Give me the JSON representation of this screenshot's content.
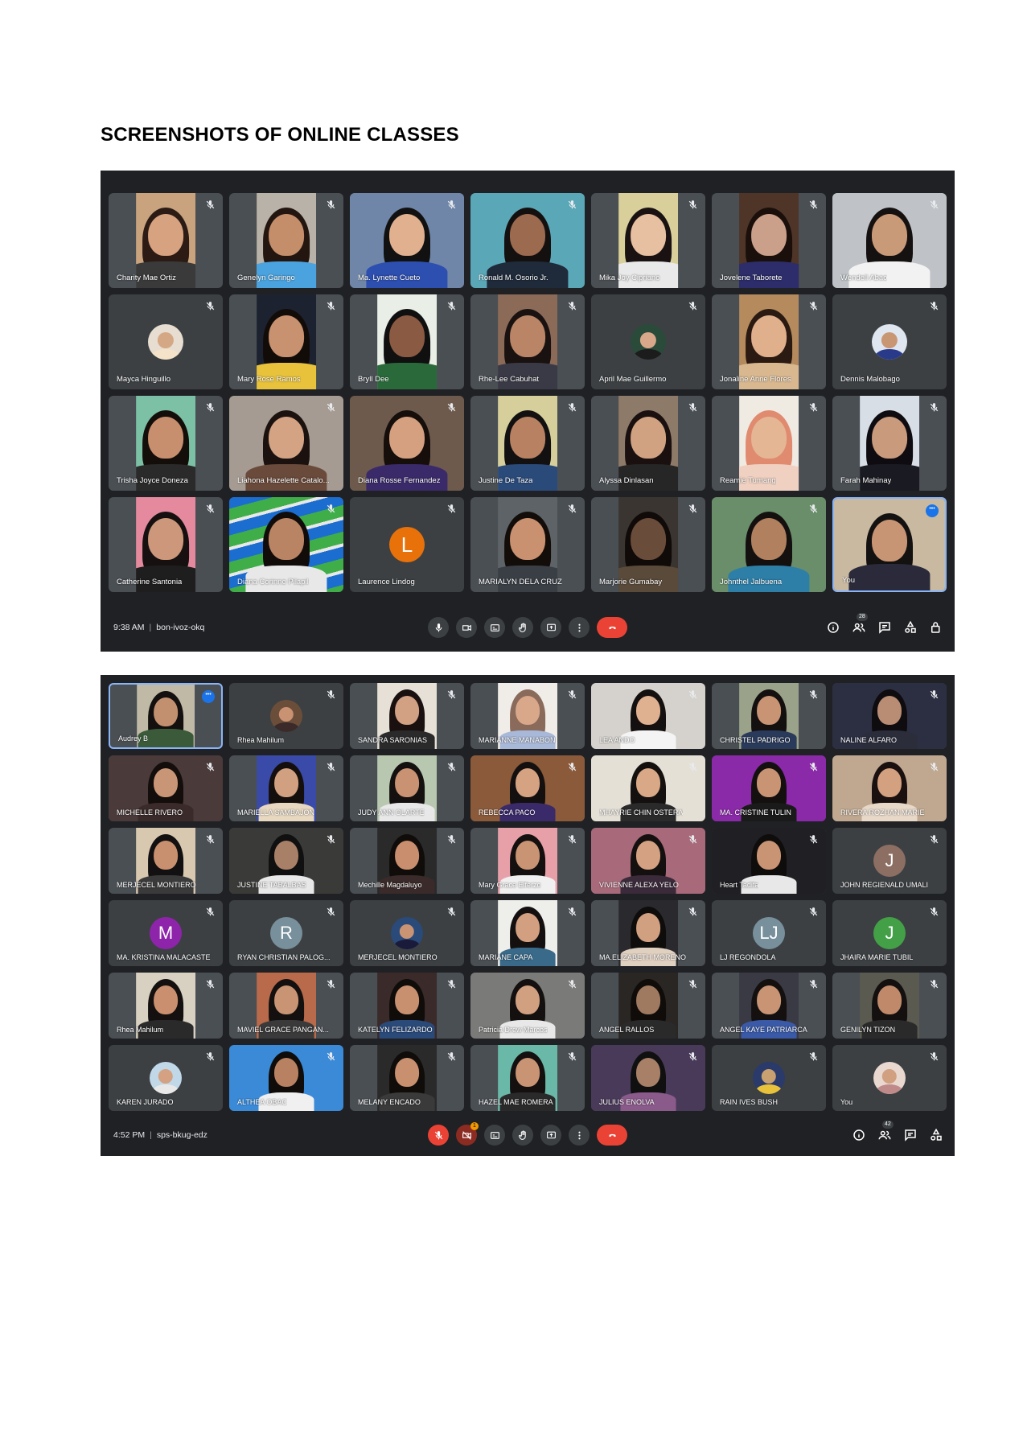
{
  "page_title": "SCREENSHOTS OF ONLINE CLASSES",
  "meeting1": {
    "time": "9:38 AM",
    "code": "bon-ivoz-okq",
    "participant_count": "28",
    "tiles": [
      {
        "name": "Charity Mae Ortiz",
        "kind": "video",
        "bg": "#c9a37e",
        "skin": "#d7a27f",
        "hair": "#2b1b14",
        "shirt": "#3a3a3a"
      },
      {
        "name": "Genelyn Garingo",
        "kind": "video",
        "bg": "#b9b2a8",
        "skin": "#c48e6b",
        "hair": "#231510",
        "shirt": "#4aa3df"
      },
      {
        "name": "Ma. Lynette Cueto",
        "kind": "wide",
        "bg": "#6f86a8",
        "skin": "#e0b08f",
        "hair": "#111111",
        "shirt": "#2d4fb0"
      },
      {
        "name": "Ronald M. Osorio Jr.",
        "kind": "wide",
        "bg": "#5aa7b8",
        "skin": "#9b6a4f",
        "hair": "#151010",
        "shirt": "#1f2a3a"
      },
      {
        "name": "Mika Joy Cipriano",
        "kind": "video",
        "bg": "#d8cf9a",
        "skin": "#e7bfa1",
        "hair": "#1a1212",
        "shirt": "#e9e9e9"
      },
      {
        "name": "Jovelene Taborete",
        "kind": "video",
        "bg": "#4e3528",
        "skin": "#caa08a",
        "hair": "#1a0f0b",
        "shirt": "#2c2d6a"
      },
      {
        "name": "Wendell Abao",
        "kind": "wide",
        "bg": "#bfc3c7",
        "skin": "#c99a78",
        "hair": "#161111",
        "shirt": "#f2f2f2"
      },
      {
        "name": "Mayca Hinguillo",
        "kind": "photo",
        "bg": "#e7ddd0",
        "skin": "#d4a785",
        "shirt": "#f4e3c8"
      },
      {
        "name": "Mary Rose Ramos",
        "kind": "video",
        "bg": "#1d2230",
        "skin": "#c89170",
        "hair": "#120c09",
        "shirt": "#e8c23a"
      },
      {
        "name": "Bryll Dee",
        "kind": "video",
        "bg": "#e9efe6",
        "skin": "#8a5a42",
        "hair": "#101010",
        "shirt": "#2a6a3a"
      },
      {
        "name": "Rhe-Lee Cabuhat",
        "kind": "video",
        "bg": "#8c6a58",
        "skin": "#b98566",
        "hair": "#1a1210",
        "shirt": "#3a3a46"
      },
      {
        "name": "April Mae Guillermo",
        "kind": "photo",
        "bg": "#2a4a3a",
        "skin": "#d9a88a",
        "shirt": "#1c1c1c"
      },
      {
        "name": "Jonaline Anne Flores",
        "kind": "video",
        "bg": "#b58b5d",
        "skin": "#e0af8c",
        "hair": "#2a1a12",
        "shirt": "#d9b890"
      },
      {
        "name": "Dennis Malobago",
        "kind": "photo",
        "bg": "#dfe6f0",
        "skin": "#c99674",
        "shirt": "#2a3a8a"
      },
      {
        "name": "Trisha Joyce Doneza",
        "kind": "video",
        "bg": "#7cc0a5",
        "skin": "#c88f6e",
        "hair": "#140e0b",
        "shirt": "#2a2a2a"
      },
      {
        "name": "Liahona Hazelette Catalo...",
        "kind": "wide",
        "bg": "#a59b92",
        "skin": "#d3a384",
        "hair": "#1b1210",
        "shirt": "#6a4a3a"
      },
      {
        "name": "Diana Rosse Fernandez",
        "kind": "wide",
        "bg": "#6d5a4c",
        "skin": "#d4a080",
        "hair": "#150e0b",
        "shirt": "#3a2a6a"
      },
      {
        "name": "Justine De Taza",
        "kind": "video",
        "bg": "#d6cf9b",
        "skin": "#b88162",
        "hair": "#121010",
        "shirt": "#2a4a7a"
      },
      {
        "name": "Alyssa Dinlasan",
        "kind": "video",
        "bg": "#8e7a68",
        "skin": "#d0a282",
        "hair": "#1a1010",
        "shirt": "#262626"
      },
      {
        "name": "Reamie Tumang",
        "kind": "video",
        "bg": "#efeae2",
        "skin": "#e4b693",
        "hair": "#e08a70",
        "shirt": "#f0d0c0"
      },
      {
        "name": "Farah Mahinay",
        "kind": "video",
        "bg": "#d8dee6",
        "skin": "#c99a7c",
        "hair": "#0e0c10",
        "shirt": "#1a1a22"
      },
      {
        "name": "Catherine Santonia",
        "kind": "video",
        "bg": "#e58a9e",
        "skin": "#cc977a",
        "hair": "#161010",
        "shirt": "#1e1e1e"
      },
      {
        "name": "Diana Corinne Pilapil",
        "kind": "stripes",
        "bg": "#1c6dd0",
        "skin": "#b98464",
        "hair": "#110c0a",
        "shirt": "#e8e8e8"
      },
      {
        "name": "Laurence Lindog",
        "kind": "letter",
        "letter": "L",
        "color": "#e8710a"
      },
      {
        "name": "MARIALYN DELA CRUZ",
        "kind": "video",
        "bg": "#5d6367",
        "skin": "#c99170",
        "hair": "#130d0a",
        "shirt": "#3a3f46"
      },
      {
        "name": "Marjorie Gumabay",
        "kind": "video",
        "bg": "#3a3530",
        "skin": "#6a4c3a",
        "hair": "#100a08",
        "shirt": "#5a4a3a"
      },
      {
        "name": "Johnthel Jalbuena",
        "kind": "wide",
        "bg": "#6a8e6a",
        "skin": "#b0805f",
        "hair": "#141010",
        "shirt": "#2d7fa8"
      },
      {
        "name": "You",
        "kind": "wide",
        "bg": "#c9b9a0",
        "skin": "#c89574",
        "hair": "#141111",
        "shirt": "#2a2a3a",
        "pinned": true
      }
    ]
  },
  "meeting2": {
    "time": "4:52 PM",
    "code": "sps-bkug-edz",
    "participant_count": "42",
    "notification_count": "1",
    "tiles": [
      {
        "name": "Audrey B",
        "kind": "video",
        "bg": "#c0b9a6",
        "skin": "#c2906f",
        "hair": "#141010",
        "shirt": "#3a5a3a",
        "pinned": true
      },
      {
        "name": "Rhea Mahilum",
        "kind": "photo",
        "bg": "#6a4e3a",
        "skin": "#c99272",
        "shirt": "#3a2a2a"
      },
      {
        "name": "SANDRA SARONIAS",
        "kind": "video",
        "bg": "#e6e0d6",
        "skin": "#d2a083",
        "hair": "#1a1010",
        "shirt": "#2a2a2a"
      },
      {
        "name": "MARIANNE MANABON",
        "kind": "video",
        "bg": "#f0ede8",
        "skin": "#d9a88a",
        "hair": "#8a6a5a",
        "shirt": "#a8b8d8"
      },
      {
        "name": "LEA ANDO",
        "kind": "wide",
        "bg": "#d5d2cd",
        "skin": "#e0b190",
        "hair": "#151010",
        "shirt": "#f4f4f4"
      },
      {
        "name": "CHRISTEL PADRIGO",
        "kind": "video",
        "bg": "#9aa38a",
        "skin": "#c99474",
        "hair": "#141010",
        "shirt": "#2a3a5a"
      },
      {
        "name": "NALINE ALFARO",
        "kind": "wide",
        "bg": "#2c2f42",
        "skin": "#b98c74",
        "hair": "#0f0c10",
        "shirt": "#2b2d3b"
      },
      {
        "name": "MICHELLE RIVERO",
        "kind": "wide",
        "bg": "#4a3a3a",
        "skin": "#c99577",
        "hair": "#130d0b",
        "shirt": "#3a2a2a"
      },
      {
        "name": "MARIELLA SAMBAJON",
        "kind": "video",
        "bg": "#3a4aa8",
        "skin": "#d0a080",
        "hair": "#140f0c",
        "shirt": "#e8d8c0"
      },
      {
        "name": "JUDY ANN OLARTE",
        "kind": "video",
        "bg": "#b8c8b0",
        "skin": "#c99272",
        "hair": "#141010",
        "shirt": "#e8e8e8"
      },
      {
        "name": "REBECCA PACO",
        "kind": "wide",
        "bg": "#8a5a3a",
        "skin": "#d5a282",
        "hair": "#141010",
        "shirt": "#3a2a6a"
      },
      {
        "name": "MHAYRIE CHIN OSTERA",
        "kind": "wide",
        "bg": "#e5e0d6",
        "skin": "#d9a886",
        "hair": "#141010",
        "shirt": "#2a2a2a"
      },
      {
        "name": "MA. CRISTINE TULIN",
        "kind": "wide",
        "bg": "#8a2aa8",
        "skin": "#c99474",
        "hair": "#141010",
        "shirt": "#1a1a1a"
      },
      {
        "name": "RIVERA ROZHAN MARIE",
        "kind": "wide",
        "bg": "#c0a890",
        "skin": "#d3a080",
        "hair": "#1a1010",
        "shirt": "#e8d8c8"
      },
      {
        "name": "MERJECEL MONTIERO",
        "kind": "video",
        "bg": "#d8c8b0",
        "skin": "#c99070",
        "hair": "#121010",
        "shirt": "#3a3a3a"
      },
      {
        "name": "JUSTINE TABALBAS",
        "kind": "wide",
        "bg": "#3a3a38",
        "skin": "#a88068",
        "hair": "#101010",
        "shirt": "#e8e8e8"
      },
      {
        "name": "Mechille Magdaluyo",
        "kind": "video",
        "bg": "#2a2a2a",
        "skin": "#c98e6e",
        "hair": "#0f0c0a",
        "shirt": "#3a2a2a"
      },
      {
        "name": "Mary Grace Elferzo",
        "kind": "video",
        "bg": "#e8a0a8",
        "skin": "#c99474",
        "hair": "#141010",
        "shirt": "#f0f0f0"
      },
      {
        "name": "VIVIENNE ALEXA YELO",
        "kind": "wide",
        "bg": "#a86a7a",
        "skin": "#d4a282",
        "hair": "#151010",
        "shirt": "#3a2a3a"
      },
      {
        "name": "Heart Tadifa",
        "kind": "wide",
        "bg": "#1f1f24",
        "skin": "#c89474",
        "hair": "#0f0c0c",
        "shirt": "#e8e8e8"
      },
      {
        "name": "JOHN REGIENALD UMALI",
        "kind": "letter",
        "letter": "J",
        "color": "#8d6e63"
      },
      {
        "name": "MA. KRISTINA MALACASTE",
        "kind": "letter",
        "letter": "M",
        "color": "#8e24aa"
      },
      {
        "name": "RYAN CHRISTIAN PALOG...",
        "kind": "letter",
        "letter": "R",
        "color": "#78909c"
      },
      {
        "name": "MERJECEL MONTIERO",
        "kind": "photo",
        "bg": "#2a4a7a",
        "skin": "#c99474",
        "shirt": "#1a1a3a"
      },
      {
        "name": "MARIANE CAPA",
        "kind": "video",
        "bg": "#eeeeea",
        "skin": "#d2a080",
        "hair": "#141010",
        "shirt": "#3a6a8a"
      },
      {
        "name": "MA.ELIZABETH MORENO",
        "kind": "video",
        "bg": "#2a2a2e",
        "skin": "#d0a080",
        "hair": "#0f0c0c",
        "shirt": "#e0d0c0"
      },
      {
        "name": "LJ REGONDOLA",
        "kind": "letter",
        "letter": "LJ",
        "color": "#78909c"
      },
      {
        "name": "JHAIRA MARIE TUBIL",
        "kind": "letter",
        "letter": "J",
        "color": "#43a047"
      },
      {
        "name": "Rhea Mahilum",
        "kind": "video",
        "bg": "#d8d0c0",
        "skin": "#c98f6e",
        "hair": "#141010",
        "shirt": "#2a2a2a"
      },
      {
        "name": "MAVIEL GRACE PANGAN...",
        "kind": "video",
        "bg": "#b86a4a",
        "skin": "#c99474",
        "hair": "#141010",
        "shirt": "#3a3a3a"
      },
      {
        "name": "KATELYN FELIZARDO",
        "kind": "video",
        "bg": "#3a2a2a",
        "skin": "#c99070",
        "hair": "#0f0c0a",
        "shirt": "#2a4a7a"
      },
      {
        "name": "Patricia Drew Marcos",
        "kind": "wide",
        "bg": "#7a7a78",
        "skin": "#d0a080",
        "hair": "#141010",
        "shirt": "#e8e8e8"
      },
      {
        "name": "ANGEL RALLOS",
        "kind": "video",
        "bg": "#2a2624",
        "skin": "#a07a60",
        "hair": "#0f0c0a",
        "shirt": "#2a2a2a"
      },
      {
        "name": "ANGEL KAYE PATRIARCA",
        "kind": "video",
        "bg": "#3a3a44",
        "skin": "#c99474",
        "hair": "#141010",
        "shirt": "#3a5aa8"
      },
      {
        "name": "GENILYN TIZON",
        "kind": "video",
        "bg": "#5a5a50",
        "skin": "#c08a6a",
        "hair": "#141010",
        "shirt": "#2a2a2a"
      },
      {
        "name": "KAREN JURADO",
        "kind": "photo",
        "bg": "#c0d8e8",
        "skin": "#d4a282",
        "shirt": "#e8e8e8"
      },
      {
        "name": "ALTHEA OBAC",
        "kind": "wide",
        "bg": "#3a8ad8",
        "skin": "#b88262",
        "hair": "#0f0c0a",
        "shirt": "#f0f0f0"
      },
      {
        "name": "MELANY ENCADO",
        "kind": "video",
        "bg": "#2a2a2a",
        "skin": "#c99070",
        "hair": "#0f0c0a",
        "shirt": "#3a3a3a"
      },
      {
        "name": "HAZEL MAE ROMERA",
        "kind": "video",
        "bg": "#6ab8a8",
        "skin": "#c99474",
        "hair": "#141010",
        "shirt": "#2a2a2a"
      },
      {
        "name": "JULIUS ENOLVA",
        "kind": "wide",
        "bg": "#4a3a5a",
        "skin": "#a88068",
        "hair": "#101010",
        "shirt": "#8a5a8a"
      },
      {
        "name": "RAIN IVES BUSH",
        "kind": "photo",
        "bg": "#2a3a6a",
        "skin": "#c9a070",
        "shirt": "#e8c23a"
      },
      {
        "name": "You",
        "kind": "photo",
        "bg": "#e8d8d0",
        "skin": "#d0a080",
        "shirt": "#c08a8a"
      }
    ]
  }
}
